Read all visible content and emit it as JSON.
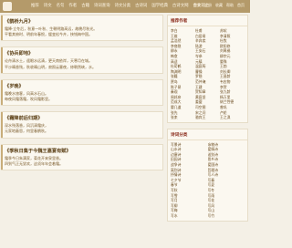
{
  "header": {
    "nav": [
      "推荐",
      "诗文",
      "名句",
      "作者",
      "古籍",
      "诗词查询",
      "诗文分类",
      "古诗词",
      "国学经典",
      "古诗文网",
      "古文观止"
    ],
    "links": [
      "登录",
      "注册",
      "收藏",
      "帮助",
      "首页"
    ]
  },
  "poems": [
    {
      "title": "《鹊桥九月》",
      "lines": [
        "霜降·立冬后，秋意一叶秋、生朝明路高远，故晚尽秋光。",
        "平看其俯时、明前年春恨，缓变松今卉，挟钱梅中国。"
      ]
    },
    {
      "title": "《协兵即地》",
      "lines": [
        "论舟清水土，遥眼水远清，更天南依岸，天寒月在城。",
        "平沙晴香残，秋收晴山明，寂照云塞夜，修朝然峡，水。"
      ]
    },
    {
      "title": "《岁晚》",
      "lines": [
        "霜晚水旅客，风高水石山。",
        "每夜风霜落霜，吹风霜影里。"
      ]
    },
    {
      "title": "《霜降前后归期》",
      "lines": [
        "深水残落香，风沉清霜庆，",
        "元家地蔽思，何里春鹊秋。"
      ]
    },
    {
      "title": "《季秋日集于今魏王嘉宴有赋》",
      "lines": [
        "霜季今日朱满家，菊花开来泉里香。",
        "四到气正无犹欢，这须年年会着霜。"
      ]
    }
  ],
  "sidebar": {
    "authors_title": "推荐作者",
    "authors": [
      "李白",
      "杜甫",
      "苏轼",
      "王维",
      "白居易",
      "李清照",
      "孟浩然",
      "辛弃疾",
      "杜牧",
      "李商隐",
      "陆游",
      "欧阳修",
      "柳永",
      "王安石",
      "刘禹锡",
      "韩愈",
      "岑参",
      "柳宗元",
      "高适",
      "元稹",
      "晏殊",
      "杜荀鹤",
      "温庭筠",
      "王勃",
      "陶渊明",
      "曹操",
      "刘长卿",
      "张籍",
      "罗隐",
      "王昌龄",
      "贾岛",
      "范仲淹",
      "韦应物",
      "陈子昂",
      "王建",
      "李贺",
      "秦观",
      "贺知章",
      "张九龄",
      "周邦彦",
      "黄庭坚",
      "杨万里",
      "范成大",
      "姜夔",
      "纳兰性德",
      "晏几道",
      "司空图",
      "曾巩",
      "张先",
      "宋之问",
      "卢纶",
      "张耒",
      "骆宾王",
      "王之涣"
    ],
    "cats_title": "诗词分类",
    "cats": [
      "写景诗",
      "咏物诗",
      "山水诗",
      "爱情诗",
      "边塞诗",
      "送别诗",
      "田园诗",
      "思乡诗",
      "战争诗",
      "爱国诗",
      "离别诗",
      "哲理诗",
      "抒情诗",
      "写人诗",
      "七夕节",
      "写春",
      "春节",
      "写夏",
      "写秋",
      "写冬",
      "写雪",
      "写雨",
      "写月",
      "写花",
      "写柳",
      "写风",
      "写梅",
      "写山",
      "写水",
      "写竹"
    ]
  }
}
